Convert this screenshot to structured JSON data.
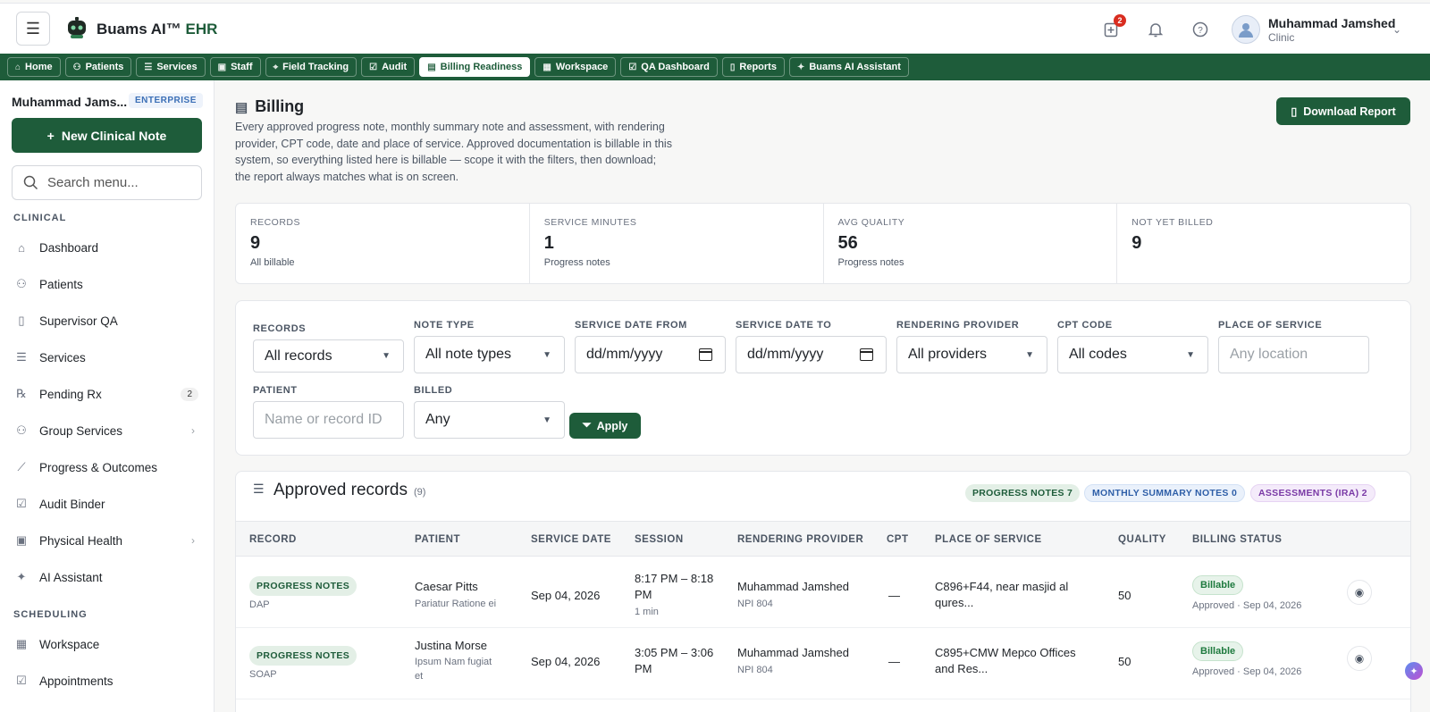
{
  "header": {
    "brand": "Buams AI™",
    "brand_suffix": "EHR",
    "notification_count": "2",
    "user_name": "Muhammad Jamshed",
    "user_role": "Clinic"
  },
  "nav_tabs": [
    {
      "label": "Home",
      "icon": "home-icon"
    },
    {
      "label": "Patients",
      "icon": "users-icon"
    },
    {
      "label": "Services",
      "icon": "list-icon"
    },
    {
      "label": "Staff",
      "icon": "badge-icon"
    },
    {
      "label": "Field Tracking",
      "icon": "pin-icon"
    },
    {
      "label": "Audit",
      "icon": "check-square-icon"
    },
    {
      "label": "Billing Readiness",
      "icon": "receipt-icon",
      "active": true
    },
    {
      "label": "Workspace",
      "icon": "calendar-icon"
    },
    {
      "label": "QA Dashboard",
      "icon": "check-square-icon"
    },
    {
      "label": "Reports",
      "icon": "file-icon"
    },
    {
      "label": "Buams AI Assistant",
      "icon": "sparkle-icon"
    }
  ],
  "sidebar": {
    "user_name": "Muhammad Jams...",
    "plan_badge": "ENTERPRISE",
    "new_note_label": "New Clinical Note",
    "search_placeholder": "Search menu...",
    "section_clinical": "CLINICAL",
    "section_scheduling": "SCHEDULING",
    "items": [
      {
        "label": "Dashboard",
        "icon": "home-icon"
      },
      {
        "label": "Patients",
        "icon": "users-icon"
      },
      {
        "label": "Supervisor QA",
        "icon": "clipboard-icon"
      },
      {
        "label": "Services",
        "icon": "list-icon"
      },
      {
        "label": "Pending Rx",
        "icon": "rx-icon",
        "count": "2"
      },
      {
        "label": "Group Services",
        "icon": "group-icon"
      },
      {
        "label": "Progress & Outcomes",
        "icon": "chart-icon"
      },
      {
        "label": "Audit Binder",
        "icon": "check-square-icon"
      },
      {
        "label": "Physical Health",
        "icon": "health-icon"
      },
      {
        "label": "AI Assistant",
        "icon": "sparkle-icon"
      },
      {
        "label": "Workspace",
        "icon": "calendar-icon"
      },
      {
        "label": "Appointments",
        "icon": "calendar-check-icon"
      }
    ]
  },
  "page": {
    "title": "Billing",
    "description": "Every approved progress note, monthly summary note and assessment, with rendering provider, CPT code, date and place of service. Approved documentation is billable in this system, so everything listed here is billable — scope it with the filters, then download; the report always matches what is on screen.",
    "download_label": "Download Report"
  },
  "stats": [
    {
      "label": "RECORDS",
      "value": "9",
      "sub": "All billable"
    },
    {
      "label": "SERVICE MINUTES",
      "value": "1",
      "sub": "Progress notes"
    },
    {
      "label": "AVG QUALITY",
      "value": "56",
      "sub": "Progress notes"
    },
    {
      "label": "NOT YET BILLED",
      "value": "9",
      "sub": ""
    }
  ],
  "filters": {
    "records_label": "RECORDS",
    "records_value": "All records",
    "note_type_label": "NOTE TYPE",
    "note_type_value": "All note types",
    "date_from_label": "SERVICE DATE FROM",
    "date_from_value": "dd/mm/yyyy",
    "date_to_label": "SERVICE DATE TO",
    "date_to_value": "dd/mm/yyyy",
    "provider_label": "RENDERING PROVIDER",
    "provider_value": "All providers",
    "cpt_label": "CPT CODE",
    "cpt_value": "All codes",
    "place_label": "PLACE OF SERVICE",
    "place_placeholder": "Any location",
    "patient_label": "PATIENT",
    "patient_placeholder": "Name or record ID",
    "billed_label": "BILLED",
    "billed_value": "Any",
    "apply_label": "Apply"
  },
  "records": {
    "title": "Approved records",
    "count": "(9)",
    "pills": [
      {
        "label": "PROGRESS NOTES 7",
        "color": "#1e5c3a",
        "bg": "#e3efe6"
      },
      {
        "label": "MONTHLY SUMMARY NOTES 0",
        "color": "#2f5fa8",
        "bg": "#eaf1fb"
      },
      {
        "label": "ASSESSMENTS (IRA) 2",
        "color": "#7a3aa6",
        "bg": "#f4ebfa"
      }
    ],
    "columns": [
      "RECORD",
      "PATIENT",
      "SERVICE DATE",
      "SESSION",
      "RENDERING PROVIDER",
      "CPT",
      "PLACE OF SERVICE",
      "QUALITY",
      "BILLING STATUS"
    ],
    "rows": [
      {
        "record_type": "PROGRESS NOTES",
        "record_sub": "DAP",
        "patient": "Caesar Pitts",
        "patient_sub": "Pariatur Ratione ei",
        "service_date": "Sep 04, 2026",
        "session_line1": "8:17 PM – 8:18",
        "session_line2": "PM",
        "session_dur": "1 min",
        "provider": "Muhammad Jamshed",
        "npi": "NPI 804",
        "cpt": "—",
        "place_line1": "C896+F44, near masjid al",
        "place_line2": "qures...",
        "quality": "50",
        "status": "Billable",
        "status_sub": "Approved · Sep 04, 2026"
      },
      {
        "record_type": "PROGRESS NOTES",
        "record_sub": "SOAP",
        "patient": "Justina Morse",
        "patient_sub_line1": "Ipsum Nam fugiat",
        "patient_sub_line2": "et",
        "service_date": "Sep 04, 2026",
        "session_line1": "3:05 PM – 3:06",
        "session_line2": "PM",
        "provider": "Muhammad Jamshed",
        "npi": "NPI 804",
        "cpt": "—",
        "place_line1": "C895+CMW Mepco Offices",
        "place_line2": "and Res...",
        "quality": "50",
        "status": "Billable",
        "status_sub": "Approved · Sep 04, 2026"
      }
    ]
  },
  "colors": {
    "brand_green": "#1e5c3a",
    "badge_red": "#d92d20"
  }
}
